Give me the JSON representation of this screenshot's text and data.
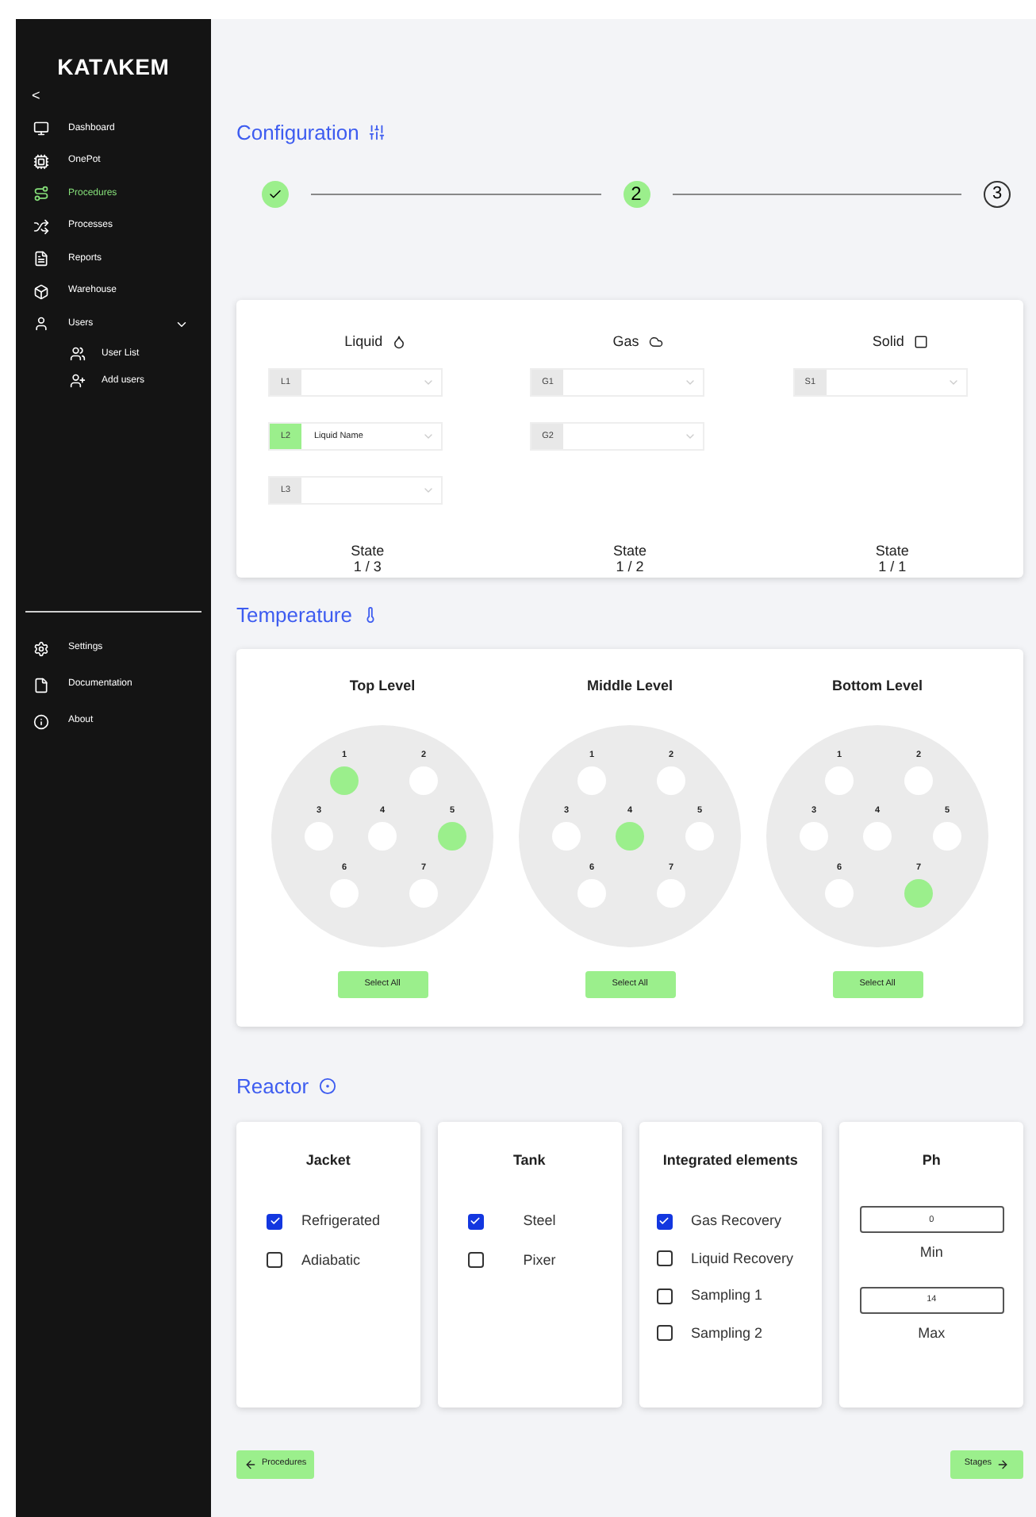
{
  "sidebar": {
    "logo": "KATΛKEM",
    "back": "<",
    "items": [
      {
        "label": "Dashboard",
        "selected": false
      },
      {
        "label": "OnePot",
        "selected": false
      },
      {
        "label": "Procedures",
        "selected": true
      },
      {
        "label": "Processes",
        "selected": false
      },
      {
        "label": "Reports",
        "selected": false
      },
      {
        "label": "Warehouse",
        "selected": false
      },
      {
        "label": "Users",
        "selected": false,
        "expanded": true,
        "children": [
          {
            "label": "User List"
          },
          {
            "label": "Add users"
          }
        ]
      }
    ],
    "footer": [
      {
        "label": "Settings"
      },
      {
        "label": "Documentation"
      },
      {
        "label": "About"
      }
    ]
  },
  "configuration": {
    "title": "Configuration",
    "steps": [
      {
        "kind": "done"
      },
      {
        "label": "2",
        "kind": "current"
      },
      {
        "label": "3",
        "kind": "pending"
      }
    ],
    "columns": [
      {
        "title": "Liquid",
        "fields": [
          {
            "tag": "L1",
            "selected": false
          },
          {
            "tag": "L2",
            "selected": true,
            "value": "Liquid Name"
          },
          {
            "tag": "L3",
            "selected": false
          }
        ],
        "state_label": "State",
        "state": "1 / 3"
      },
      {
        "title": "Gas",
        "fields": [
          {
            "tag": "G1",
            "selected": false
          },
          {
            "tag": "G2",
            "selected": false
          }
        ],
        "state_label": "State",
        "state": "1 / 2"
      },
      {
        "title": "Solid",
        "fields": [
          {
            "tag": "S1",
            "selected": false
          }
        ],
        "state_label": "State",
        "state": "1 / 1"
      }
    ]
  },
  "temperature": {
    "title": "Temperature",
    "levels": [
      {
        "title": "Top Level",
        "button": "Select All",
        "wells": [
          {
            "label": "1",
            "selected": true
          },
          {
            "label": "2",
            "selected": false
          },
          {
            "label": "3",
            "selected": false
          },
          {
            "label": "4",
            "selected": false
          },
          {
            "label": "5",
            "selected": true
          },
          {
            "label": "6",
            "selected": false
          },
          {
            "label": "7",
            "selected": false
          }
        ]
      },
      {
        "title": "Middle Level",
        "button": "Select All",
        "wells": [
          {
            "label": "1",
            "selected": false
          },
          {
            "label": "2",
            "selected": false
          },
          {
            "label": "3",
            "selected": false
          },
          {
            "label": "4",
            "selected": true
          },
          {
            "label": "5",
            "selected": false
          },
          {
            "label": "6",
            "selected": false
          },
          {
            "label": "7",
            "selected": false
          }
        ]
      },
      {
        "title": "Bottom Level",
        "button": "Select All",
        "wells": [
          {
            "label": "1",
            "selected": false
          },
          {
            "label": "2",
            "selected": false
          },
          {
            "label": "3",
            "selected": false
          },
          {
            "label": "4",
            "selected": false
          },
          {
            "label": "5",
            "selected": false
          },
          {
            "label": "6",
            "selected": false
          },
          {
            "label": "7",
            "selected": true
          }
        ]
      }
    ]
  },
  "reactor": {
    "title": "Reactor",
    "cards": [
      {
        "kind": "checklist",
        "title": "Jacket",
        "options": [
          {
            "label": "Refrigerated",
            "checked": true
          },
          {
            "label": "Adiabatic",
            "checked": false
          }
        ]
      },
      {
        "kind": "checklist",
        "title": "Tank",
        "options": [
          {
            "label": "Steel",
            "checked": true
          },
          {
            "label": "Pixer",
            "checked": false
          }
        ]
      },
      {
        "kind": "checklist",
        "title": "Integrated elements",
        "options": [
          {
            "label": "Gas Recovery",
            "checked": true
          },
          {
            "label": "Liquid Recovery",
            "checked": false
          },
          {
            "label": "Sampling 1",
            "checked": false
          },
          {
            "label": "Sampling 2",
            "checked": false
          }
        ]
      },
      {
        "kind": "range",
        "title": "Ph",
        "fields": [
          {
            "value": "0",
            "label": "Min"
          },
          {
            "value": "14",
            "label": "Max"
          }
        ]
      }
    ]
  },
  "nav": {
    "back": "Procedures",
    "next": "Stages"
  }
}
